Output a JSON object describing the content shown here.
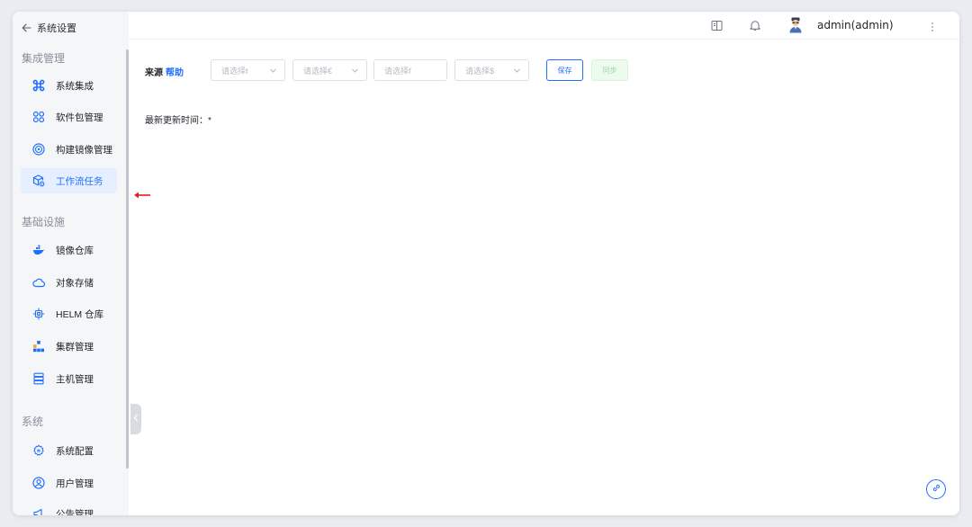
{
  "sidebar": {
    "back_label": "系统设置",
    "sections": [
      {
        "title": "集成管理",
        "items": [
          {
            "label": "系统集成",
            "icon": "command-icon"
          },
          {
            "label": "软件包管理",
            "icon": "grid-dots-icon"
          },
          {
            "label": "构建镜像管理",
            "icon": "target-icon"
          },
          {
            "label": "工作流任务",
            "icon": "box-gear-icon",
            "active": true
          }
        ]
      },
      {
        "title": "基础设施",
        "items": [
          {
            "label": "镜像仓库",
            "icon": "docker-whale-icon"
          },
          {
            "label": "对象存储",
            "icon": "cloud-icon"
          },
          {
            "label": "HELM 仓库",
            "icon": "helm-wheel-icon"
          },
          {
            "label": "集群管理",
            "icon": "cluster-icon"
          },
          {
            "label": "主机管理",
            "icon": "server-icon"
          }
        ]
      },
      {
        "title": "系统",
        "items": [
          {
            "label": "系统配置",
            "icon": "settings-gear-icon"
          },
          {
            "label": "用户管理",
            "icon": "user-circle-icon"
          },
          {
            "label": "公告管理",
            "icon": "megaphone-icon"
          }
        ]
      }
    ]
  },
  "header": {
    "user": "admin(admin)"
  },
  "toolbar": {
    "source_label": "来源",
    "help_label": "帮助",
    "selects": [
      {
        "placeholder": "请选择t"
      },
      {
        "placeholder": "请选择€"
      },
      {
        "placeholder": "请选择f"
      },
      {
        "placeholder": "请选择$"
      }
    ],
    "save_label": "保存",
    "sync_label": "同步"
  },
  "main": {
    "update_label": "最新更新时间：",
    "update_value": "*"
  },
  "colors": {
    "accent": "#1f6fff",
    "active_bg": "#e6efff",
    "sync_green": "#9ad8a6",
    "annotation_red": "#e02020"
  }
}
